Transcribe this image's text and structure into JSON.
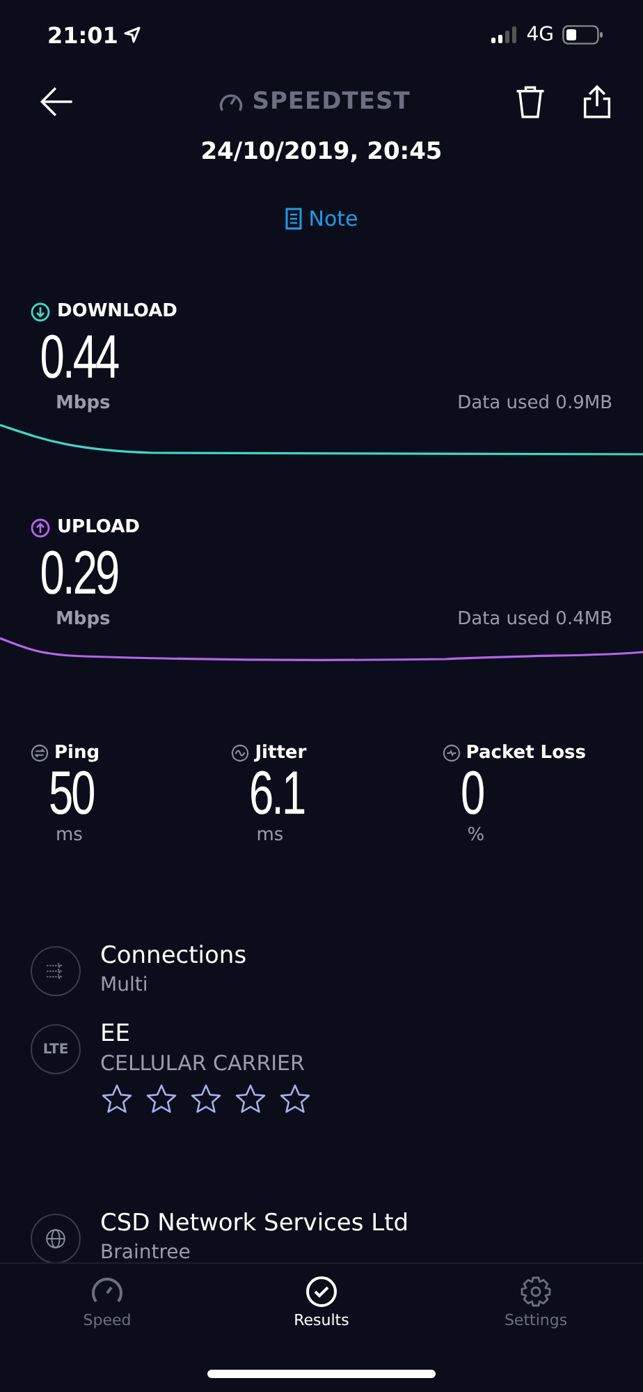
{
  "status_bar": {
    "time": "21:01",
    "network": "4G"
  },
  "header": {
    "logo": "SPEEDTEST",
    "date": "24/10/2019, 20:45",
    "note": "Note"
  },
  "tests": [
    {
      "kind": "download",
      "label": "DOWNLOAD",
      "value": "0.44",
      "unit": "Mbps",
      "data_used": "Data used 0.9MB",
      "color": "#3fd6c4"
    },
    {
      "kind": "upload",
      "label": "UPLOAD",
      "value": "0.29",
      "unit": "Mbps",
      "data_used": "Data used 0.4MB",
      "color": "#b565e8"
    }
  ],
  "metrics": [
    {
      "kind": "ping",
      "label": "Ping",
      "value": "50",
      "unit": "ms"
    },
    {
      "kind": "jitter",
      "label": "Jitter",
      "value": "6.1",
      "unit": "ms"
    },
    {
      "kind": "loss",
      "label": "Packet Loss",
      "value": "0",
      "unit": "%"
    }
  ],
  "details": [
    {
      "kind": "connections",
      "title": "Connections",
      "subtitle": "Multi"
    },
    {
      "kind": "carrier",
      "icon_text": "LTE",
      "title": "EE",
      "subtitle": "CELLULAR CARRIER",
      "stars": 0
    },
    {
      "kind": "isp",
      "title": "CSD Network Services Ltd",
      "subtitle": "Braintree"
    }
  ],
  "tabs": [
    {
      "kind": "speed",
      "label": "Speed",
      "selected": false
    },
    {
      "kind": "results",
      "label": "Results",
      "selected": true
    },
    {
      "kind": "settings",
      "label": "Settings",
      "selected": false
    }
  ]
}
